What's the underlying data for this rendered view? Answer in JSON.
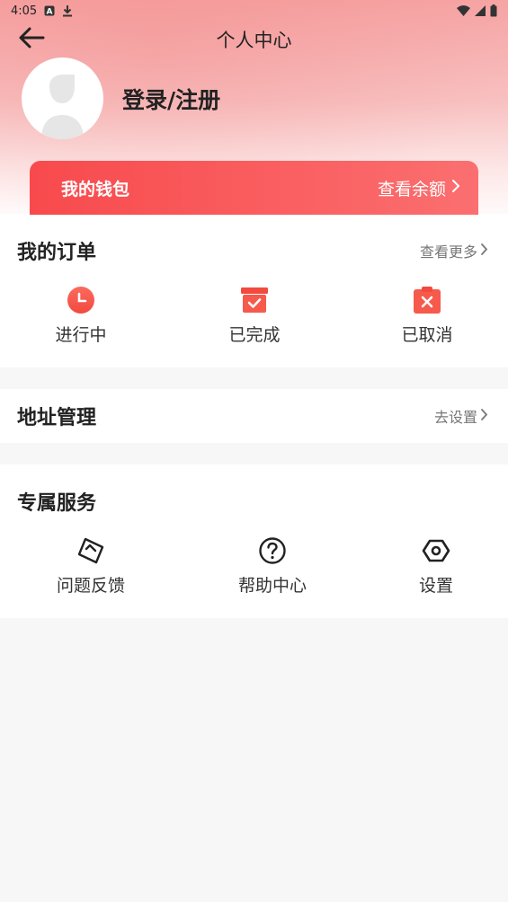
{
  "status_bar": {
    "time": "4:05"
  },
  "header": {
    "title": "个人中心"
  },
  "profile": {
    "login_label": "登录/注册"
  },
  "wallet": {
    "title": "我的钱包",
    "link_label": "查看余额"
  },
  "orders": {
    "title": "我的订单",
    "more_label": "查看更多",
    "items": [
      {
        "label": "进行中",
        "icon": "clock-icon"
      },
      {
        "label": "已完成",
        "icon": "box-check-icon"
      },
      {
        "label": "已取消",
        "icon": "clipboard-cancel-icon"
      }
    ]
  },
  "address": {
    "title": "地址管理",
    "link_label": "去设置"
  },
  "services": {
    "title": "专属服务",
    "items": [
      {
        "label": "问题反馈",
        "icon": "feedback-icon"
      },
      {
        "label": "帮助中心",
        "icon": "help-circle-icon"
      },
      {
        "label": "设置",
        "icon": "gear-hex-icon"
      }
    ]
  },
  "colors": {
    "accent": "#f84a4d",
    "header_bg": "#f8b3b3",
    "page_bg": "#f7f7f7"
  }
}
